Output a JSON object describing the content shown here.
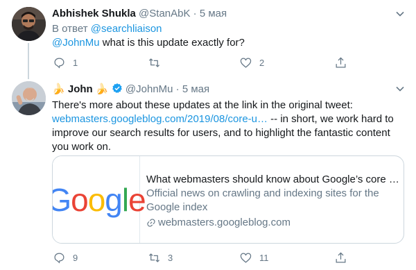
{
  "tweet1": {
    "name": "Abhishek Shukla",
    "handle": "@StanAbK",
    "dot": "·",
    "date": "5 мая",
    "reply_prefix": "В ответ",
    "reply_to": "@searchliaison",
    "mention": "@JohnMu",
    "text": " what is this update exactly for?",
    "reply_count": "1",
    "retweet_count": "",
    "like_count": "2"
  },
  "tweet2": {
    "name_emoji_left": "🍌",
    "name": "John",
    "name_emoji_right": "🍌",
    "handle": "@JohnMu",
    "dot": "·",
    "date": "5 мая",
    "text_part1": "There's more about these updates at the link in the original tweet: ",
    "link": "webmasters.googleblog.com/2019/08/core-u…",
    "text_part2": " -- in short, we work hard to improve our search results for users, and to highlight the fantastic content you work on.",
    "card": {
      "title": "What webmasters should know about Google’s core …",
      "description": "Official news on crawling and indexing sites for the Google index",
      "domain": "webmasters.googleblog.com",
      "logo_letters": [
        "G",
        "o",
        "o",
        "g",
        "l",
        "e"
      ]
    },
    "reply_count": "9",
    "retweet_count": "3",
    "like_count": "11"
  },
  "colors": {
    "accent": "#1b95e0",
    "muted": "#657786",
    "verified": "#1da1f2",
    "google_blue": "#4285f4",
    "google_red": "#ea4335",
    "google_yellow": "#fbbc05",
    "google_green": "#34a853"
  },
  "icons": {
    "reply": "speech-bubble-icon",
    "retweet": "retweet-icon",
    "like": "heart-icon",
    "share": "share-icon",
    "more": "chevron-down-icon",
    "verified": "verified-badge-icon",
    "link": "link-icon"
  }
}
